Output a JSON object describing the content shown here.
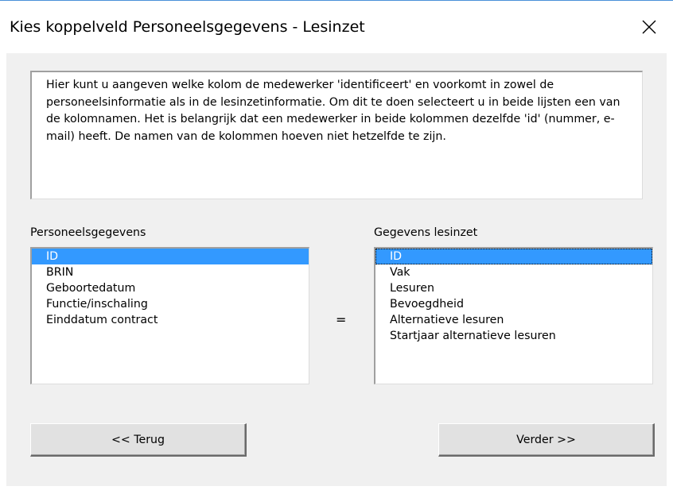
{
  "window": {
    "title": "Kies koppelveld Personeelsgegevens - Lesinzet",
    "close_icon": "close-icon"
  },
  "description": "Hier kunt u aangeven welke kolom de medewerker 'identificeert' en voorkomt in zowel de personeelsinformatie als in de lesinzetinformatie. Om dit te doen selecteert u in beide lijsten een van de kolomnamen. Het is belangrijk dat een medewerker in beide kolommen dezelfde 'id' (nummer, e-mail) heeft. De namen van de kolommen hoeven niet hetzelfde te zijn.",
  "left_list": {
    "label": "Personeelsgegevens",
    "items": [
      "ID",
      "BRIN",
      "Geboortedatum",
      "Functie/inschaling",
      "Einddatum contract"
    ],
    "selected": "ID"
  },
  "equals": "=",
  "right_list": {
    "label": "Gegevens lesinzet",
    "items": [
      "ID",
      "Vak",
      "Lesuren",
      "Bevoegdheid",
      "Alternatieve lesuren",
      "Startjaar alternatieve lesuren"
    ],
    "selected": "ID"
  },
  "buttons": {
    "back": "<< Terug",
    "next": "Verder >>"
  },
  "colors": {
    "selection": "#3399ff",
    "dialog_background": "#f0f0f0",
    "title_border": "#4a90d9"
  }
}
